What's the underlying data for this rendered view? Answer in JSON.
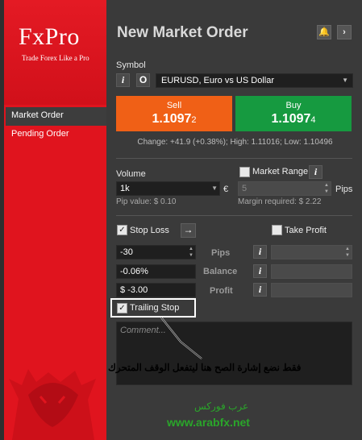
{
  "brand": {
    "logo": "FxPro",
    "tagline": "Trade Forex Like a Pro"
  },
  "sidebar": {
    "items": [
      {
        "label": "Market Order",
        "active": true
      },
      {
        "label": "Pending Order",
        "active": false
      }
    ]
  },
  "header": {
    "title": "New Market Order",
    "icons": [
      "bell-icon",
      "chevron-right-icon"
    ]
  },
  "symbol": {
    "label": "Symbol",
    "value": "EURUSD, Euro vs US Dollar",
    "info_glyph": "i",
    "other_glyph": "O"
  },
  "sell": {
    "label": "Sell",
    "price_main": "1.1097",
    "price_small": "2",
    "color": "#f06016"
  },
  "buy": {
    "label": "Buy",
    "price_main": "1.1097",
    "price_small": "4",
    "color": "#169a40"
  },
  "change_line": "Change: +41.9 (+0.38%); High: 1.11016; Low: 1.10496",
  "volume": {
    "label": "Volume",
    "value": "1k",
    "currency": "€",
    "pip_value": "Pip value: $ 0.10"
  },
  "market_range": {
    "label": "Market Range",
    "checked": false,
    "value": "5",
    "unit": "Pips",
    "margin": "Margin required: $ 2.22"
  },
  "stop_loss": {
    "label": "Stop Loss",
    "checked": true,
    "arrow": "→",
    "pips": "-30",
    "balance": "-0.06%",
    "profit": "$ -3.00"
  },
  "take_profit": {
    "label": "Take Profit",
    "checked": false
  },
  "row_labels": {
    "pips": "Pips",
    "balance": "Balance",
    "profit": "Profit"
  },
  "trailing_stop": {
    "label": "Trailing Stop",
    "checked": true
  },
  "comment": {
    "placeholder": "Comment..."
  },
  "annotation": "فقط نضع إشارة الصح هنا ليتفعل الوقف المتحرك",
  "footer": {
    "arabic": "عرب فوركس",
    "url": "www.arabfx.net",
    "color": "#2aa62a"
  }
}
